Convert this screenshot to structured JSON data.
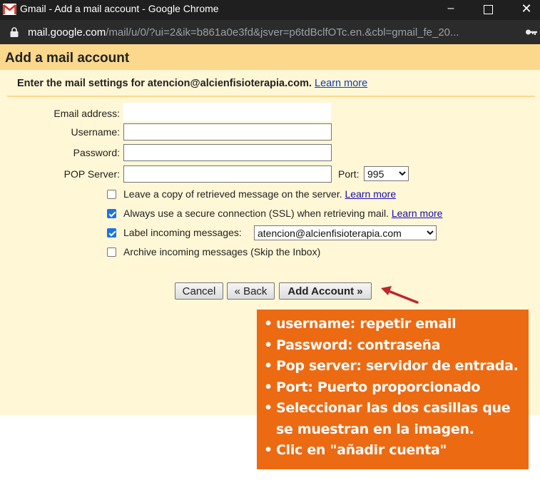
{
  "window": {
    "title": "Gmail - Add a mail account - Google Chrome",
    "minimize_glyph": "–",
    "close_glyph": "✕"
  },
  "address_bar": {
    "host": "mail.google.com",
    "path": "/mail/u/0/?ui=2&ik=b861a0e3fd&jsver=p6tdBclfOTc.en.&cbl=gmail_fe_20..."
  },
  "dialog": {
    "title": "Add a mail account",
    "instructions": "Enter the mail settings for atencion@alcienfisioterapia.com.",
    "learn_more": "Learn more"
  },
  "form": {
    "email_label": "Email address:",
    "email_value": "",
    "username_label": "Username:",
    "username_value": "",
    "password_label": "Password:",
    "password_value": "",
    "pop_server_label": "POP Server:",
    "pop_server_value": "",
    "port_label": "Port:",
    "port_value": "995",
    "leave_copy": {
      "label": "Leave a copy of retrieved message on the server.",
      "checked": false,
      "link": "Learn more"
    },
    "ssl": {
      "label": "Always use a secure connection (SSL) when retrieving mail.",
      "checked": true,
      "link": "Learn more"
    },
    "label_incoming": {
      "label": "Label incoming messages:",
      "checked": true,
      "value": "atencion@alcienfisioterapia.com"
    },
    "archive": {
      "label": "Archive incoming messages (Skip the Inbox)",
      "checked": false
    }
  },
  "buttons": {
    "cancel": "Cancel",
    "back": "« Back",
    "add_account": "Add Account »"
  },
  "annotation": {
    "items": [
      "username: repetir email",
      "Password: contraseña",
      "Pop server: servidor de entrada.",
      "Port: Puerto proporcionado",
      "Seleccionar las dos casillas que se muestran en la imagen.",
      "Clic en \"añadir cuenta\""
    ]
  },
  "colors": {
    "page_bg": "#fff7d6",
    "header_bg": "#fbd88b",
    "annotation_bg": "#ec6a12",
    "arrow": "#c0262d",
    "checkbox_checked": "#1a73e8"
  }
}
